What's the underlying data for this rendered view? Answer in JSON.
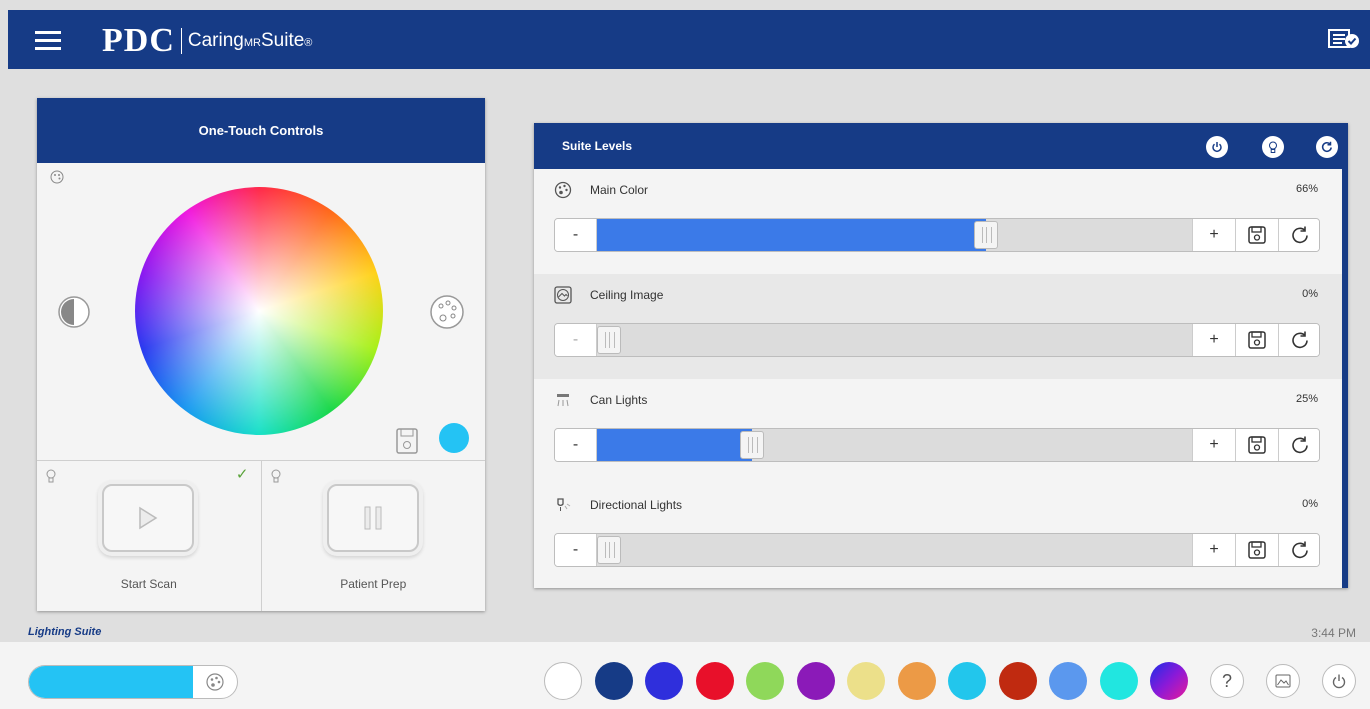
{
  "app": {
    "brand": "PDC",
    "suite_name": "Caring",
    "suite_mr": "MR",
    "suite_tail": "Suite",
    "trademark": "®"
  },
  "one_touch": {
    "title": "One-Touch Controls",
    "selected_color": "#24c3f4",
    "scenes": [
      {
        "label": "Start Scan",
        "icon": "play-icon",
        "active": true
      },
      {
        "label": "Patient Prep",
        "icon": "pause-icon",
        "active": false
      }
    ]
  },
  "suite_levels": {
    "title": "Suite Levels",
    "header_icons": [
      "power-icon",
      "bulb-icon",
      "reset-icon"
    ],
    "rows": [
      {
        "label": "Main Color",
        "value": "66%",
        "level": 0.66,
        "icon": "palette-icon"
      },
      {
        "label": "Ceiling Image",
        "value": "0%",
        "level": 0.0,
        "icon": "image-icon"
      },
      {
        "label": "Can Lights",
        "value": "25%",
        "level": 0.25,
        "icon": "can-light-icon"
      },
      {
        "label": "Directional Lights",
        "value": "0%",
        "level": 0.0,
        "icon": "directional-light-icon"
      }
    ],
    "minus_label": "-",
    "plus_label": "+"
  },
  "footer": {
    "app_label": "Lighting Suite",
    "time": "3:44 PM",
    "selector_color": "#24c3f4",
    "swatches": [
      "#ffffff",
      "#163b86",
      "#2f2fdc",
      "#e8102a",
      "#8fd85a",
      "#8b1ab8",
      "#ece08a",
      "#ec9a46",
      "#22c6ec",
      "#c02a10",
      "#5b98ee",
      "#21e6e0",
      "gradient"
    ],
    "help_label": "?"
  },
  "colors": {
    "brand_blue": "#163b86",
    "slider_fill": "#3b7ae8"
  }
}
